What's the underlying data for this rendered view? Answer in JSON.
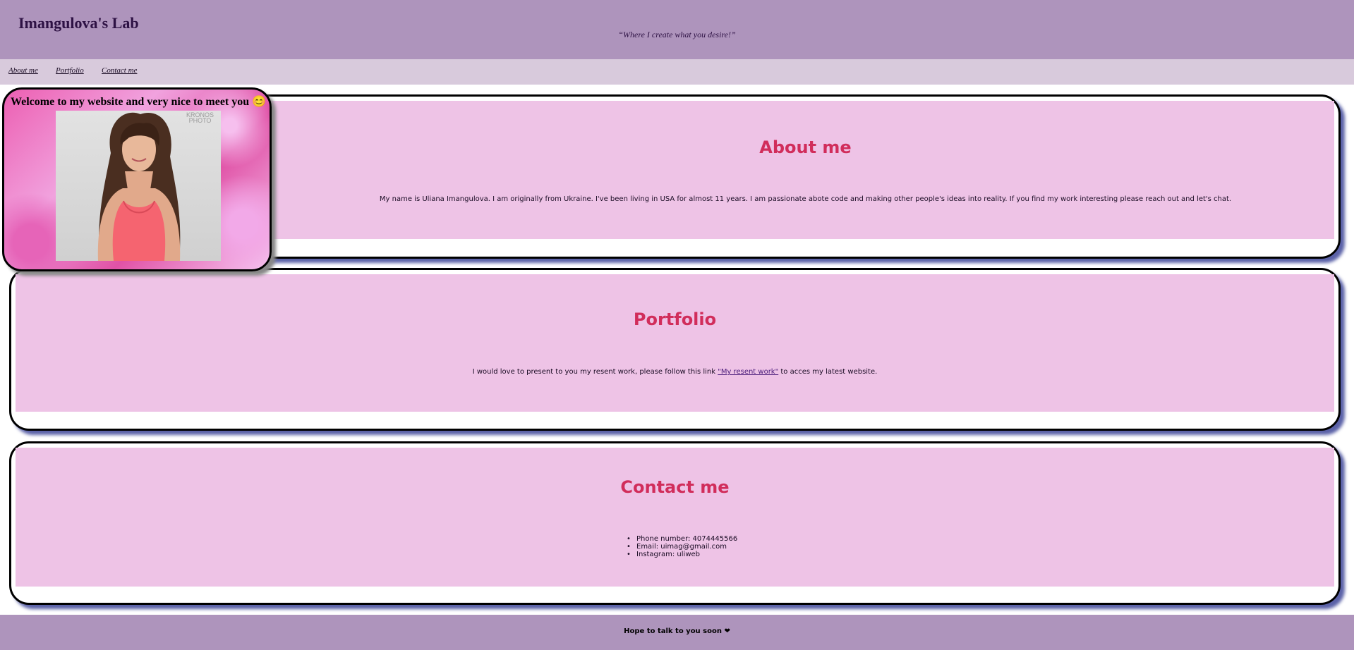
{
  "header": {
    "title": "Imangulova's Lab",
    "tagline": "“Where I create what you desire!”"
  },
  "nav": {
    "items": [
      {
        "label": "About me"
      },
      {
        "label": "Portfolio"
      },
      {
        "label": "Contact me"
      }
    ]
  },
  "welcome": {
    "text": "Welcome to my website and very nice to meet you 😊",
    "photo_watermark": "KRONOS PHOTO"
  },
  "about": {
    "heading": "About me",
    "text": "My name is Uliana Imangulova. I am originally from Ukraine. I've been living in USA for almost 11 years. I am passionate abote code and making other people's ideas into reality. If you find my work interesting please reach out and let's chat."
  },
  "portfolio": {
    "heading": "Portfolio",
    "text_before": "I would love to present to you my resent work, please follow this link ",
    "link_text": "\"My resent work\"",
    "text_after": " to acces my latest website."
  },
  "contact": {
    "heading": "Contact me",
    "items": [
      "Phone number: 4074445566",
      "Email: uimag@gmail.com",
      "Instagram: uliweb"
    ]
  },
  "footer": {
    "text": "Hope to talk to you soon ❤"
  },
  "colors": {
    "header_bg": "#ae94bc",
    "nav_bg": "#d8cadc",
    "section_bg": "#eec3e6",
    "heading": "#d12d5b",
    "shadow": "#5b62a8"
  }
}
